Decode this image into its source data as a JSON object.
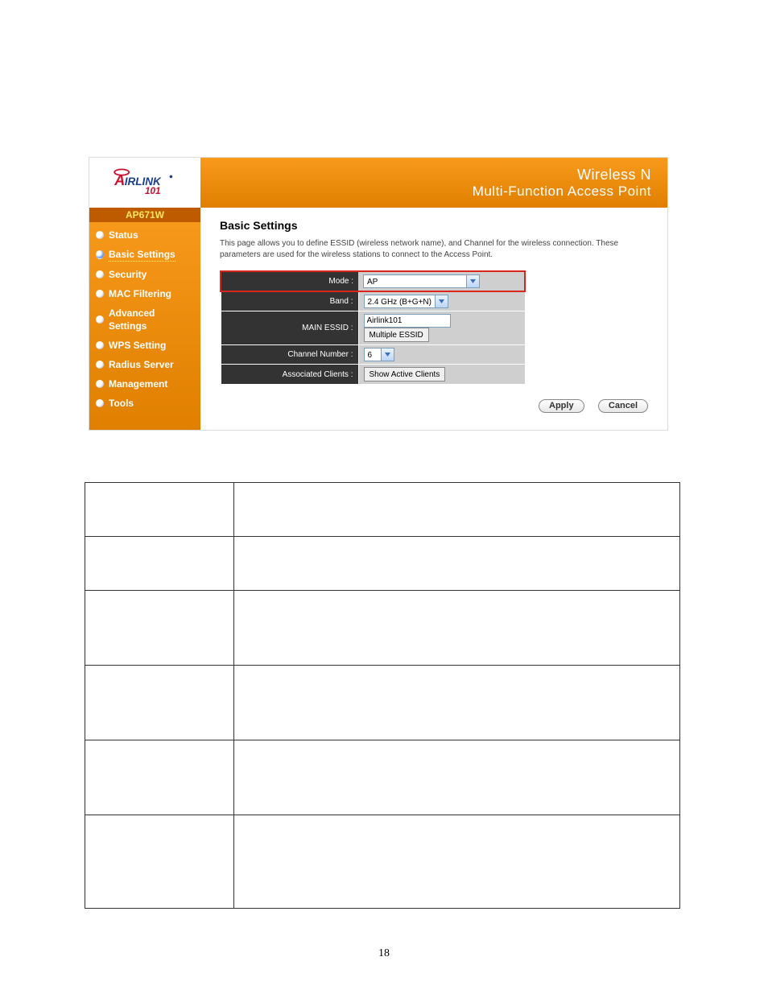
{
  "logo_text": "AirLink 101",
  "header": {
    "line1": "Wireless N",
    "line2": "Multi-Function Access Point"
  },
  "model": "AP671W",
  "sidebar": {
    "items": [
      {
        "label": "Status",
        "active": false
      },
      {
        "label": "Basic Settings",
        "active": true
      },
      {
        "label": "Security",
        "active": false
      },
      {
        "label": "MAC Filtering",
        "active": false
      },
      {
        "label": "Advanced Settings",
        "active": false
      },
      {
        "label": "WPS Setting",
        "active": false
      },
      {
        "label": "Radius Server",
        "active": false
      },
      {
        "label": "Management",
        "active": false
      },
      {
        "label": "Tools",
        "active": false
      }
    ]
  },
  "page_title": "Basic Settings",
  "description": "This page allows you to define ESSID (wireless network name), and Channel for the wireless connection. These parameters are used for the wireless stations to connect to the Access Point.",
  "form": {
    "mode": {
      "label": "Mode :",
      "value": "AP"
    },
    "band": {
      "label": "Band :",
      "value": "2.4 GHz (B+G+N)"
    },
    "essid": {
      "label": "MAIN ESSID :",
      "value": "Airlink101",
      "button": "Multiple ESSID"
    },
    "channel": {
      "label": "Channel Number :",
      "value": "6"
    },
    "clients": {
      "label": "Associated Clients :",
      "button": "Show Active Clients"
    }
  },
  "buttons": {
    "apply": "Apply",
    "cancel": "Cancel"
  },
  "page_number": "18"
}
